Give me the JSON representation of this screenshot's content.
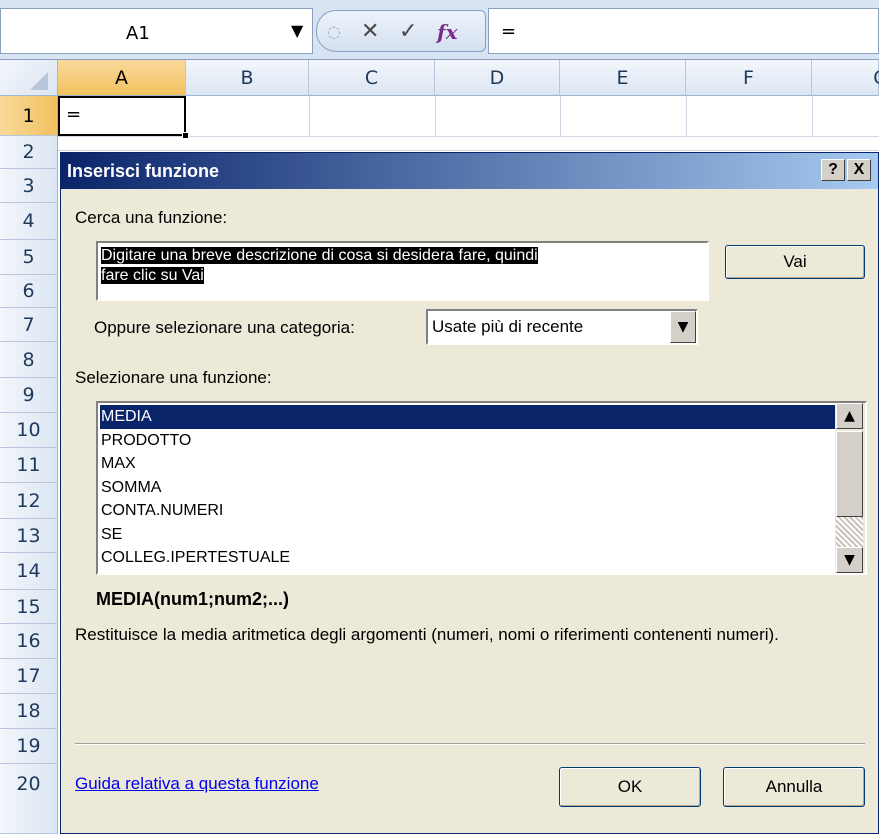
{
  "formula_bar": {
    "name_box": "A1",
    "formula": "="
  },
  "grid": {
    "columns": [
      "A",
      "B",
      "C",
      "D",
      "E",
      "F",
      "G"
    ],
    "rows": [
      "1",
      "2",
      "3",
      "4",
      "5",
      "6",
      "7",
      "8",
      "9",
      "10",
      "11",
      "12",
      "13",
      "14",
      "15",
      "16",
      "17",
      "18",
      "19",
      "20"
    ],
    "active_cell_value": "="
  },
  "dialog": {
    "title": "Inserisci funzione",
    "help_btn": "?",
    "close_btn": "X",
    "search_label": "Cerca una funzione:",
    "search_value_line1": "Digitare una breve descrizione di cosa si desidera fare, quindi",
    "search_value_line2": "fare clic su Vai",
    "go_button": "Vai",
    "category_label": "Oppure selezionare una categoria:",
    "category_value": "Usate più di recente",
    "select_label": "Selezionare una funzione:",
    "functions": [
      "MEDIA",
      "PRODOTTO",
      "MAX",
      "SOMMA",
      "CONTA.NUMERI",
      "SE",
      "COLLEG.IPERTESTUALE"
    ],
    "selected_function_index": 0,
    "signature": "MEDIA(num1;num2;...)",
    "description": "Restituisce la media aritmetica degli argomenti (numeri, nomi o riferimenti contenenti numeri).",
    "help_link": "Guida relativa a questa funzione",
    "ok_button": "OK",
    "cancel_button": "Annulla"
  },
  "colors": {
    "title_bar_start": "#0a246a",
    "selection": "#0a246a",
    "link": "#0000ee",
    "selected_header": "#f1c15f"
  }
}
